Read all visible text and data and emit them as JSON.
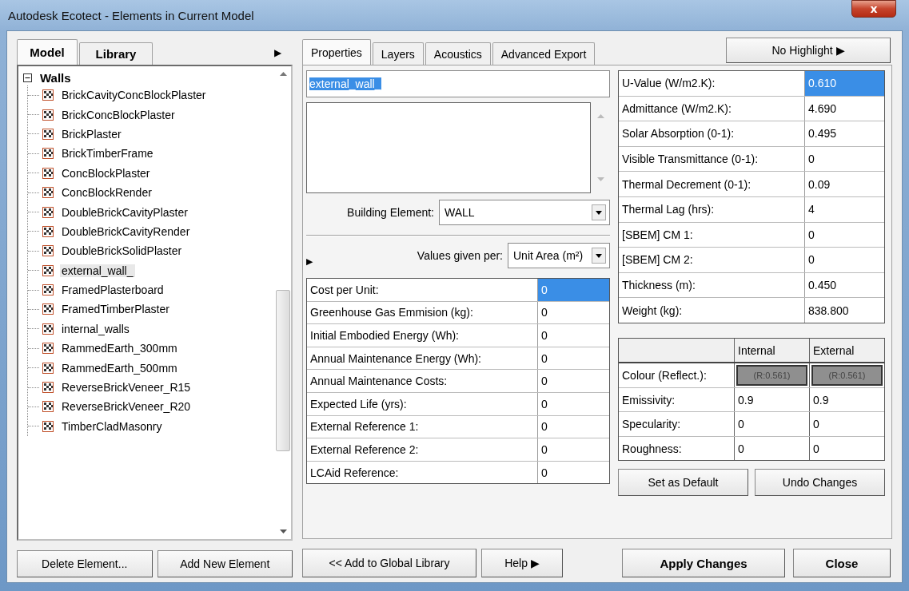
{
  "window": {
    "title": "Autodesk Ecotect - Elements in Current Model",
    "close": "x"
  },
  "left": {
    "tabs": [
      {
        "label": "Model",
        "selected": true
      },
      {
        "label": "Library",
        "selected": false
      }
    ],
    "more": "▶",
    "tree": {
      "label": "Walls",
      "expanded": true,
      "children": [
        {
          "label": "BrickCavityConcBlockPlaster",
          "selected": false
        },
        {
          "label": "BrickConcBlockPlaster",
          "selected": false
        },
        {
          "label": "BrickPlaster",
          "selected": false
        },
        {
          "label": "BrickTimberFrame",
          "selected": false
        },
        {
          "label": "ConcBlockPlaster",
          "selected": false
        },
        {
          "label": "ConcBlockRender",
          "selected": false
        },
        {
          "label": "DoubleBrickCavityPlaster",
          "selected": false
        },
        {
          "label": "DoubleBrickCavityRender",
          "selected": false
        },
        {
          "label": "DoubleBrickSolidPlaster",
          "selected": false
        },
        {
          "label": "external_wall_",
          "selected": true
        },
        {
          "label": "FramedPlasterboard",
          "selected": false
        },
        {
          "label": "FramedTimberPlaster",
          "selected": false
        },
        {
          "label": "internal_walls",
          "selected": false
        },
        {
          "label": "RammedEarth_300mm",
          "selected": false
        },
        {
          "label": "RammedEarth_500mm",
          "selected": false
        },
        {
          "label": "ReverseBrickVeneer_R15",
          "selected": false
        },
        {
          "label": "ReverseBrickVeneer_R20",
          "selected": false
        },
        {
          "label": "TimberCladMasonry",
          "selected": false
        }
      ]
    },
    "buttons": [
      {
        "label": "Delete Element..."
      },
      {
        "label": "Add New Element"
      }
    ]
  },
  "middle": {
    "tabs": [
      {
        "label": "Properties",
        "selected": true
      },
      {
        "label": "Layers",
        "selected": false
      },
      {
        "label": "Acoustics",
        "selected": false
      },
      {
        "label": "Advanced Export",
        "selected": false
      }
    ],
    "name_field": {
      "value": "external_wall_",
      "selected": true
    },
    "building_element": {
      "label": "Building Element:",
      "value": "WALL"
    },
    "values_given_per": {
      "label": "Values given per:",
      "value": "Unit Area (m²)"
    },
    "expander": "▶",
    "cost_rows": [
      {
        "label": "Cost per Unit:",
        "value": "0",
        "selected": true
      },
      {
        "label": "Greenhouse Gas Emmision (kg):",
        "value": "0",
        "selected": false
      },
      {
        "label": "Initial Embodied Energy (Wh):",
        "value": "0",
        "selected": false
      },
      {
        "label": "Annual Maintenance Energy (Wh):",
        "value": "0",
        "selected": false
      },
      {
        "label": "Annual Maintenance Costs:",
        "value": "0",
        "selected": false
      },
      {
        "label": "Expected Life (yrs):",
        "value": "0",
        "selected": false
      },
      {
        "label": "External Reference 1:",
        "value": "0",
        "selected": false
      },
      {
        "label": "External Reference 2:",
        "value": "0",
        "selected": false
      },
      {
        "label": "LCAid Reference:",
        "value": "0",
        "selected": false
      }
    ],
    "buttons": [
      {
        "label": "<< Add to Global Library"
      },
      {
        "label": "Help",
        "arrow": "▶"
      }
    ]
  },
  "right": {
    "highlight_button": {
      "label": "No Highlight",
      "arrow": "▶"
    },
    "properties": [
      {
        "label": "U-Value (W/m2.K):",
        "value": "0.610",
        "selected": true
      },
      {
        "label": "Admittance (W/m2.K):",
        "value": "4.690",
        "selected": false
      },
      {
        "label": "Solar Absorption (0-1):",
        "value": "0.495",
        "selected": false
      },
      {
        "label": "Visible Transmittance (0-1):",
        "value": "0",
        "selected": false
      },
      {
        "label": "Thermal Decrement (0-1):",
        "value": "0.09",
        "selected": false
      },
      {
        "label": "Thermal Lag (hrs):",
        "value": "4",
        "selected": false
      },
      {
        "label": "[SBEM] CM 1:",
        "value": "0",
        "selected": false
      },
      {
        "label": "[SBEM] CM 2:",
        "value": "0",
        "selected": false
      },
      {
        "label": "Thickness (m):",
        "value": "0.450",
        "selected": false
      },
      {
        "label": "Weight (kg):",
        "value": "838.800",
        "selected": false
      }
    ],
    "surface_columns": [
      "Internal",
      "External"
    ],
    "surface_rows": [
      {
        "label": "Colour (Reflect.):",
        "kind": "swatch",
        "values": [
          {
            "text": "(R:0.561)",
            "color": "#8f8f8f"
          },
          {
            "text": "(R:0.561)",
            "color": "#8f8f8f"
          }
        ]
      },
      {
        "label": "Emissivity:",
        "kind": "text",
        "values": [
          {
            "text": "0.9"
          },
          {
            "text": "0.9"
          }
        ]
      },
      {
        "label": "Specularity:",
        "kind": "text",
        "values": [
          {
            "text": "0"
          },
          {
            "text": "0"
          }
        ]
      },
      {
        "label": "Roughness:",
        "kind": "text",
        "values": [
          {
            "text": "0"
          },
          {
            "text": "0"
          }
        ]
      }
    ],
    "buttons": [
      {
        "label": "Set as Default"
      },
      {
        "label": "Undo Changes"
      }
    ],
    "footer_buttons": [
      {
        "label": "Apply Changes"
      },
      {
        "label": "Close"
      }
    ]
  }
}
